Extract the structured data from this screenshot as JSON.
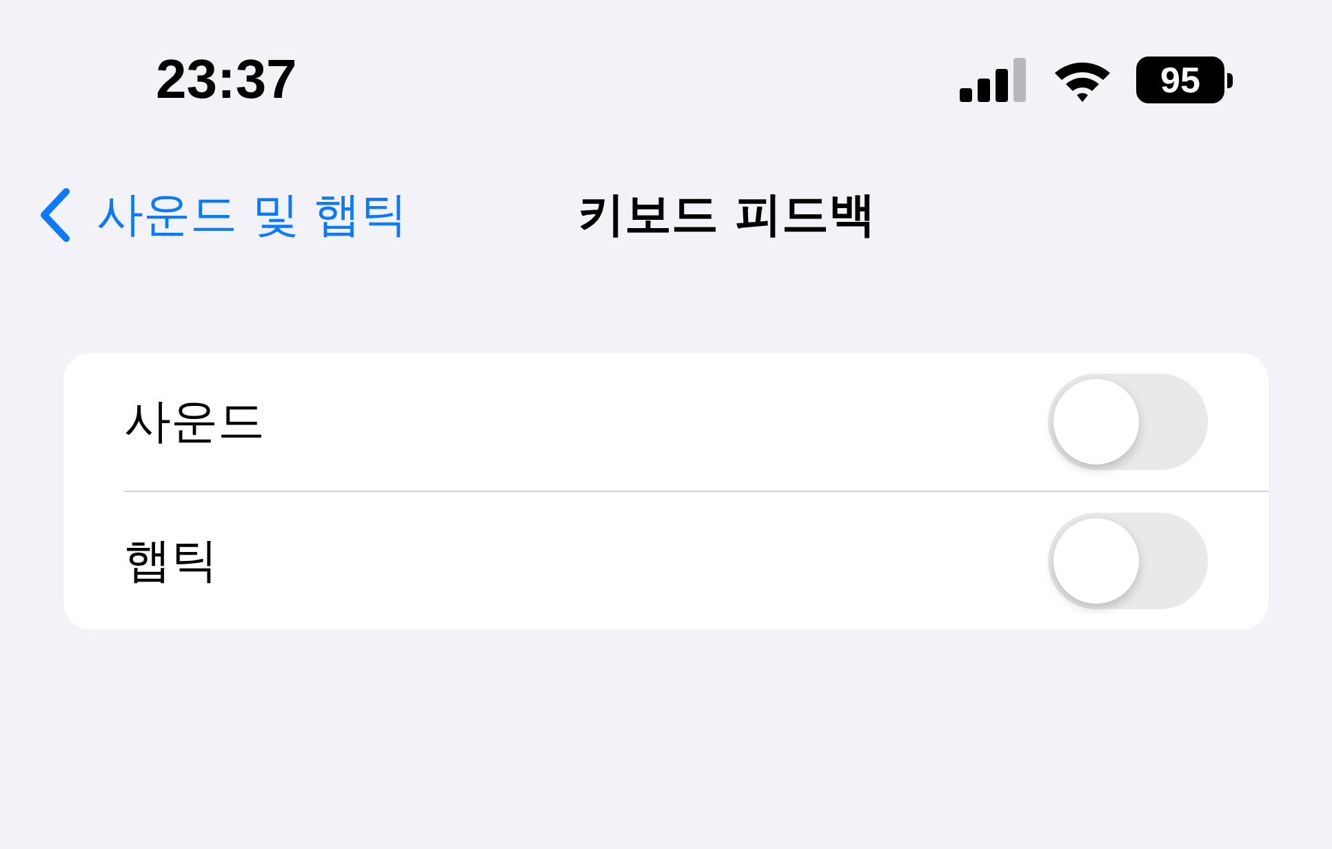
{
  "status_bar": {
    "time": "23:37",
    "battery": "95"
  },
  "nav": {
    "back": "사운드 및 햅틱",
    "title": "키보드 피드백"
  },
  "settings": [
    {
      "label": "사운드",
      "on": false
    },
    {
      "label": "햅틱",
      "on": false
    }
  ]
}
